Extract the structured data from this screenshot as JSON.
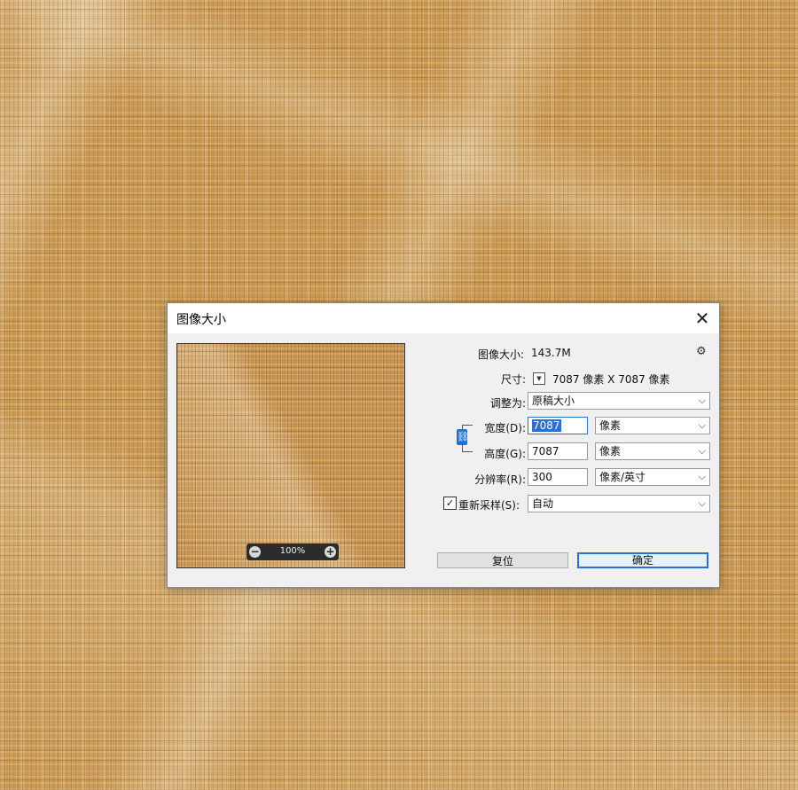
{
  "dialog": {
    "title": "图像大小",
    "close_glyph": "✕"
  },
  "preview": {
    "zoom_out_glyph": "−",
    "zoom_in_glyph": "+",
    "zoom_level": "100%"
  },
  "info": {
    "image_size_label": "图像大小:",
    "image_size_value": "143.7M",
    "gear_glyph": "⚙",
    "dimensions_label": "尺寸:",
    "dimensions_value": "7087 像素  X  7087 像素"
  },
  "fit_to": {
    "label": "调整为:",
    "value": "原稿大小"
  },
  "width": {
    "label": "宽度(D):",
    "value": "7087",
    "unit": "像素"
  },
  "height": {
    "label": "高度(G):",
    "value": "7087",
    "unit": "像素"
  },
  "resolution": {
    "label": "分辨率(R):",
    "value": "300",
    "unit": "像素/英寸"
  },
  "resample": {
    "checked": true,
    "label": "重新采样(S):",
    "value": "自动"
  },
  "buttons": {
    "reset": "复位",
    "ok": "确定"
  },
  "icons": {
    "chevron": "⌵",
    "link": "chain-link-icon",
    "check": "✓"
  },
  "colors": {
    "accent": "#2a6fd6",
    "dialog_bg": "#f0f0f0",
    "texture_base": "#c9964e"
  }
}
